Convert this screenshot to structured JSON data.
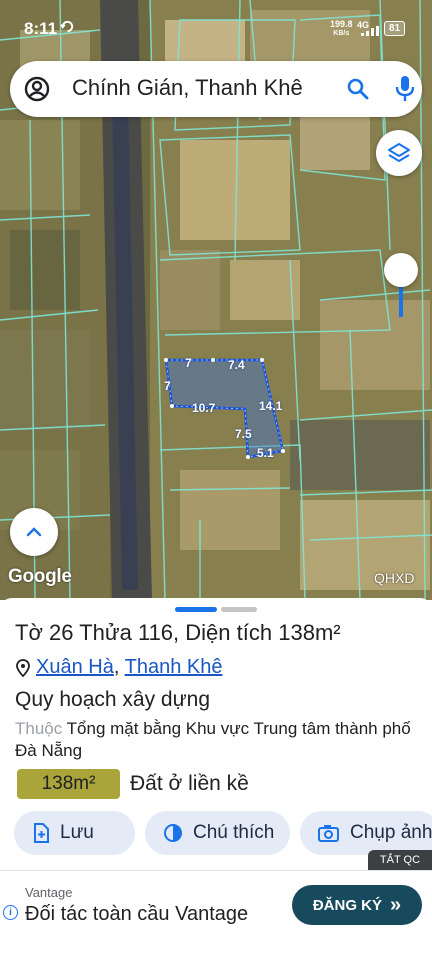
{
  "status_bar": {
    "time": "8:11",
    "net_speed_value": "199.8",
    "net_speed_unit": "KB/s",
    "network_type": "4G",
    "battery": "81"
  },
  "search": {
    "query": "Chính Gián, Thanh Khê"
  },
  "map": {
    "logo": "Google",
    "layer_label": "QHXD",
    "dimensions": [
      "7",
      "7.4",
      "7",
      "10.7",
      "14.1",
      "7.5",
      "5.1"
    ],
    "colors": {
      "parcel_outline": "#1a55d6",
      "parcel_fill": "#2b6ef2",
      "cadastral_lines": "#7fe6d6"
    }
  },
  "parcel": {
    "to_label": "Tờ",
    "to_value": "26",
    "thua_label": "Thửa",
    "thua_value": "116",
    "area_label": "Diện tích",
    "area_value": "138m²",
    "ward": "Xuân Hà",
    "district": "Thanh Khê"
  },
  "planning": {
    "title": "Quy hoạch xây dựng",
    "belongs_prefix": "Thuộc",
    "plan_name": "Tổng mặt bằng Khu vực Trung tâm thành phố Đà Nẵng",
    "area_badge": "138m²",
    "zone_type": "Đất ở liền kề",
    "badge_color": "#a9a53a"
  },
  "actions": {
    "save": "Lưu",
    "note": "Chú thích",
    "photo": "Chụp ảnh"
  },
  "ad": {
    "close_label": "TẮT QC",
    "advertiser": "Vantage",
    "headline": "Đối tác toàn cầu Vantage",
    "cta": "ĐĂNG KÝ"
  }
}
